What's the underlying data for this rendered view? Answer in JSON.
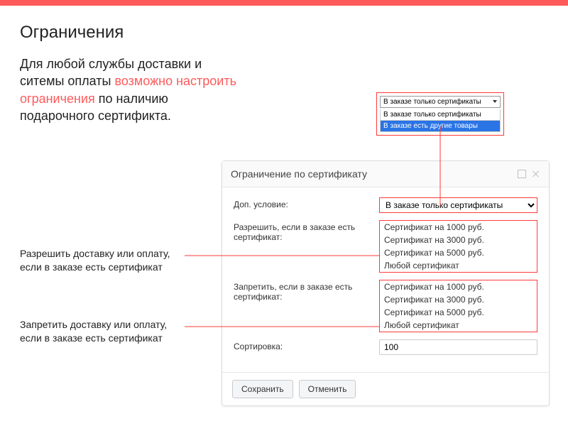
{
  "header": {
    "title": "Ограничения"
  },
  "intro": {
    "pre": "Для любой службы доставки и ситемы оплаты ",
    "hl": "возможно настроить ограничения",
    "post": " по наличию подарочного сертификта."
  },
  "notes": {
    "allow": "Разрешить доставку или оплату, если в заказе есть сертификат",
    "deny": "Запретить доставку или оплату, если в заказе есть сертификат"
  },
  "dd_illus": {
    "selected": "В заказе только сертификаты",
    "options": [
      "В заказе только сертификаты",
      "В заказе есть другие товары"
    ]
  },
  "dialog": {
    "title": "Ограничение по сертификату",
    "labels": {
      "extra": "Доп. условие:",
      "allow": "Разрешить, если в заказе есть сертификат:",
      "deny": "Запретить, если в заказе есть сертификат:",
      "sort": "Сортировка:"
    },
    "extra_value": "В заказе только сертификаты",
    "allow_list": [
      "Сертификат на 1000 руб.",
      "Сертификат на 3000 руб.",
      "Сертификат на 5000 руб.",
      "Любой сертификат"
    ],
    "deny_list": [
      "Сертификат на 1000 руб.",
      "Сертификат на 3000 руб.",
      "Сертификат на 5000 руб.",
      "Любой сертификат"
    ],
    "sort_value": "100",
    "buttons": {
      "save": "Сохранить",
      "cancel": "Отменить"
    }
  }
}
